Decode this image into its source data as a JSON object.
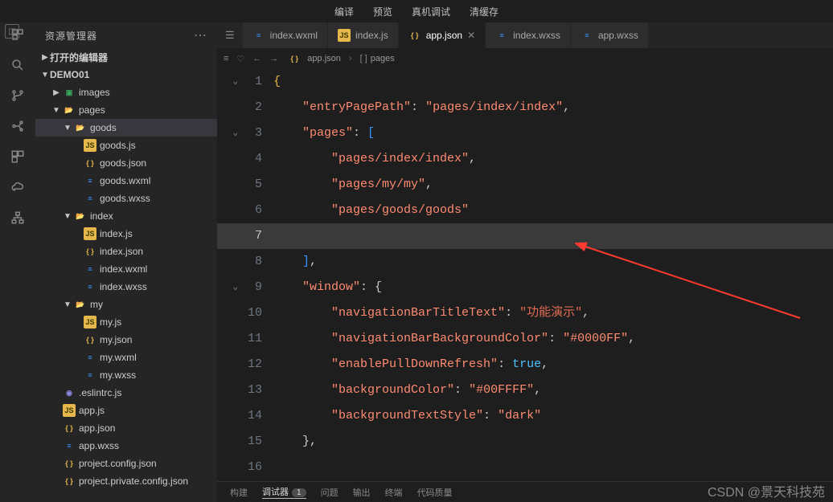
{
  "menu": {
    "compile": "编译",
    "preview": "预览",
    "realDebug": "真机调试",
    "clearCache": "清缓存"
  },
  "sidebar": {
    "title": "资源管理器",
    "openEditors": "打开的编辑器",
    "project": "DEMO01",
    "tree": {
      "images": "images",
      "pages": "pages",
      "goods": "goods",
      "goods_js": "goods.js",
      "goods_json": "goods.json",
      "goods_wxml": "goods.wxml",
      "goods_wxss": "goods.wxss",
      "index": "index",
      "index_js": "index.js",
      "index_json": "index.json",
      "index_wxml": "index.wxml",
      "index_wxss": "index.wxss",
      "my": "my",
      "my_js": "my.js",
      "my_json": "my.json",
      "my_wxml": "my.wxml",
      "my_wxss": "my.wxss",
      "eslintrc": ".eslintrc.js",
      "app_js": "app.js",
      "app_json": "app.json",
      "app_wxss": "app.wxss",
      "project_config": "project.config.json",
      "project_private": "project.private.config.json"
    }
  },
  "tabs": [
    {
      "label": "index.wxml",
      "type": "wxml"
    },
    {
      "label": "index.js",
      "type": "js"
    },
    {
      "label": "app.json",
      "type": "json",
      "active": true
    },
    {
      "label": "index.wxss",
      "type": "wxss"
    },
    {
      "label": "app.wxss",
      "type": "wxss"
    }
  ],
  "breadcrumb": {
    "file": "app.json",
    "section": "pages"
  },
  "code": {
    "l1": "{",
    "l2_key": "\"entryPagePath\"",
    "l2_val": "\"pages/index/index\"",
    "l3_key": "\"pages\"",
    "l4": "\"pages/index/index\"",
    "l5": "\"pages/my/my\"",
    "l6": "\"pages/goods/goods\"",
    "l9_key": "\"window\"",
    "l10_key": "\"navigationBarTitleText\"",
    "l10_val": "\"功能演示\"",
    "l11_key": "\"navigationBarBackgroundColor\"",
    "l11_val": "\"#0000FF\"",
    "l12_key": "\"enablePullDownRefresh\"",
    "l12_val": "true",
    "l13_key": "\"backgroundColor\"",
    "l13_val": "\"#00FFFF\"",
    "l14_key": "\"backgroundTextStyle\"",
    "l14_val": "\"dark\""
  },
  "bottom": {
    "build": "构建",
    "debugger": "调试器",
    "debugger_badge": "1",
    "issues": "问题",
    "output": "输出",
    "terminal": "终端",
    "codeQuality": "代码质量"
  },
  "watermark": "CSDN @景天科技苑"
}
